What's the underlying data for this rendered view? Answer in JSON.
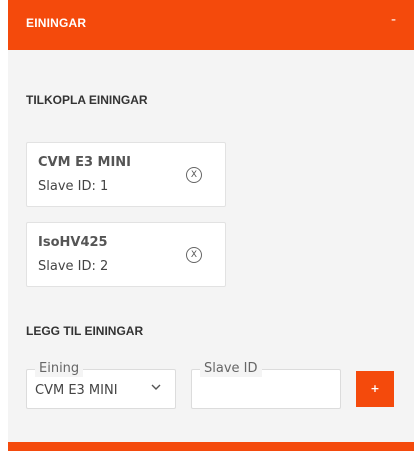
{
  "header": {
    "title": "EININGAR",
    "collapse_label": "-"
  },
  "connected": {
    "title": "TILKOPLA EININGAR",
    "units": [
      {
        "name": "CVM E3 MINI",
        "slave": "Slave ID: 1",
        "remove_label": "X"
      },
      {
        "name": "IsoHV425",
        "slave": "Slave ID: 2",
        "remove_label": "X"
      }
    ]
  },
  "add": {
    "title": "LEGG TIL EININGAR",
    "unit_field": {
      "label": "Eining",
      "value": "CVM E3 MINI"
    },
    "slave_field": {
      "label": "Slave ID",
      "value": ""
    },
    "add_button_label": "+"
  },
  "colors": {
    "accent": "#f44a0c",
    "panel_bg": "#f4f4f4"
  }
}
